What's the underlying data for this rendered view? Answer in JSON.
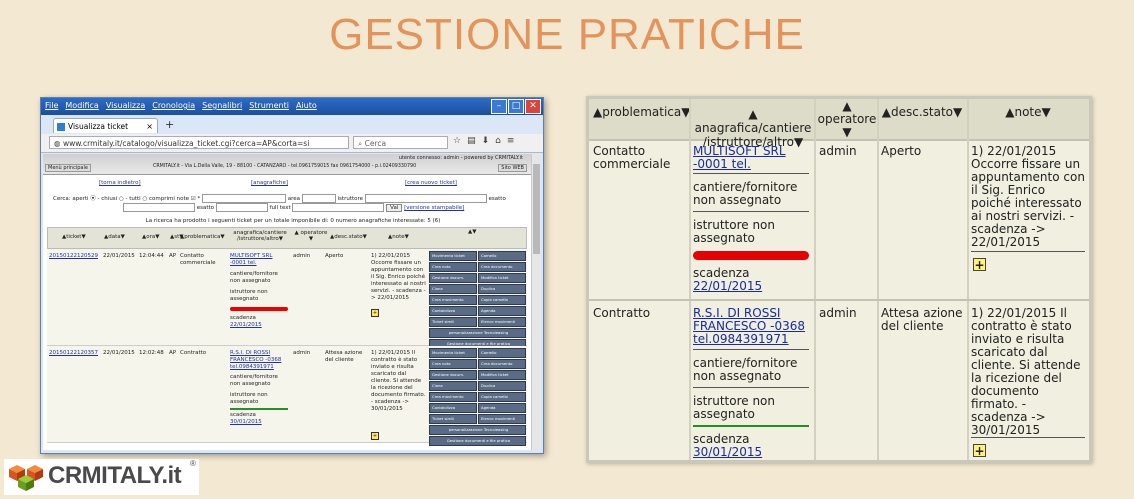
{
  "slide": {
    "title": "GESTIONE PRATICHE"
  },
  "browser": {
    "menu": [
      "File",
      "Modifica",
      "Visualizza",
      "Cronologia",
      "Segnalibri",
      "Strumenti",
      "Aiuto"
    ],
    "tab_title": "Visualizza ticket",
    "url": "www.crmitaly.it/catalogo/visualizza_ticket.cgi?cerca=AP&corta=si",
    "search_placeholder": "Cerca"
  },
  "webpage": {
    "user_info": "utente connesso: admin - powered by CRMITALY.it",
    "menu_principale": "Menù principale",
    "company_line": "CRMITALY.it - Via L.Della Valle, 19 - 88100 - CATANZARO - tel.0961759015 fax 0961754000 - p.i.02409330790",
    "sito_web": "Sito WEB",
    "links": {
      "back": "[torna indietro]",
      "anagrafiche": "[anagrafiche]",
      "new_ticket": "[crea nuovo ticket]"
    },
    "filter_line1": "Cerca: aperti ⦿ - chiusi ○ - tutti ○ comprimi note ☑ *",
    "filter_area": "area",
    "filter_istruttore": "istruttore",
    "filter_esatto": "esatto",
    "filter_esatto2": "esatto",
    "filter_fulltext": "full text",
    "filter_vai": "Vai",
    "filter_stampabile": "[versione stampabile]",
    "result_info": "La ricerca ha prodotto i seguenti ticket per un totale imponibile di: 0 numero anagrafiche interessate: 5 (6)",
    "headers": {
      "ticket": "▲ticket▼",
      "data": "▲data▼",
      "ora": "▲ora▼",
      "st": "▲st▼",
      "problematica": "▲problematica▼",
      "anagrafica": "anagrafica/cantiere /istruttore/altro▼",
      "operatore": "▲ operatore ▼",
      "stato": "▲desc.stato▼",
      "note": "▲note▼",
      "extra": "▲▼"
    },
    "rows": [
      {
        "ticket": "20150122120529",
        "data": "22/01/2015",
        "ora": "12:04:44",
        "st": "AP",
        "problematica": "Contatto commerciale",
        "anagrafica": "MULTISOFT SRL -0001 tel.",
        "cantiere": "cantiere/fornitore non assegnato",
        "istruttore": "istruttore non assegnato",
        "scadenza_label": "scadenza",
        "scadenza": "22/01/2015",
        "operatore": "admin",
        "stato": "Aperto",
        "note": "1) 22/01/2015 Occorre fissare un appuntamento con il Sig. Enrico poiché interessato ai nostri servizi. - scadenza -> 22/01/2015"
      },
      {
        "ticket": "20150122120357",
        "data": "22/01/2015",
        "ora": "12:02:48",
        "st": "AP",
        "problematica": "Contratto",
        "anagrafica": "R.S.I. DI ROSSI FRANCESCO -0368 tel.0984391971",
        "cantiere": "cantiere/fornitore non assegnato",
        "istruttore": "istruttore non assegnato",
        "scadenza_label": "scadenza",
        "scadenza": "30/01/2015",
        "operatore": "admin",
        "stato": "Attesa azione del cliente",
        "note": "1) 22/01/2015 Il contratto è stato inviato e risulta scaricato dal cliente. Si attende la ricezione del documento firmato. - scadenza -> 30/01/2015"
      }
    ],
    "actions": [
      "Movimenta ticket",
      "Camello",
      "Crea nota",
      "Crea documento",
      "Gestione docum.",
      "Modifica ticket",
      "Clona",
      "Duplica",
      "Crea movimento",
      "Copia camello",
      "Contabilizza",
      "Agenda",
      "Ticket simili",
      "Elenco movimenti"
    ],
    "actions_wide": [
      "personalizzazione Tecnoleasing",
      "Gestione documenti e file pratica"
    ]
  },
  "zoom": {
    "headers": {
      "problematica": "▲problematica▼",
      "anagrafica": "▲ anagrafica/cantiere /istruttore/altro▼",
      "operatore_up": "▲",
      "operatore": "operatore",
      "operatore_down": "▼",
      "stato": "▲desc.stato▼",
      "note": "▲note▼"
    },
    "rows": [
      {
        "problematica": "Contatto commerciale",
        "anagrafica": "MULTISOFT SRL -0001 tel.",
        "cantiere": "cantiere/fornitore non assegnato",
        "istruttore": "istruttore non assegnato",
        "scadenza_label": "scadenza",
        "scadenza": "22/01/2015",
        "operatore": "admin",
        "stato": "Aperto",
        "note": "1) 22/01/2015 Occorre fissare un appuntamento con il Sig. Enrico poiché interessato ai nostri servizi. - scadenza -> 22/01/2015"
      },
      {
        "problematica": "Contratto",
        "anagrafica": "R.S.I. DI ROSSI FRANCESCO -0368 tel.0984391971",
        "cantiere": "cantiere/fornitore non assegnato",
        "istruttore": "istruttore non assegnato",
        "scadenza_label": "scadenza",
        "scadenza": "30/01/2015",
        "operatore": "admin",
        "stato": "Attesa azione del cliente",
        "note": "1) 22/01/2015 Il contratto è stato inviato e risulta scaricato dal cliente. Si attende la ricezione del documento firmato. - scadenza -> 30/01/2015"
      }
    ],
    "add_note_icon": "add-note-icon"
  },
  "logo": {
    "text": "CRMITALY.it",
    "reg": "®"
  },
  "colors": {
    "title": "#e4935b",
    "link": "#1a2aa0",
    "red_bar": "#e60000",
    "green_bar": "#1f8f1f"
  }
}
